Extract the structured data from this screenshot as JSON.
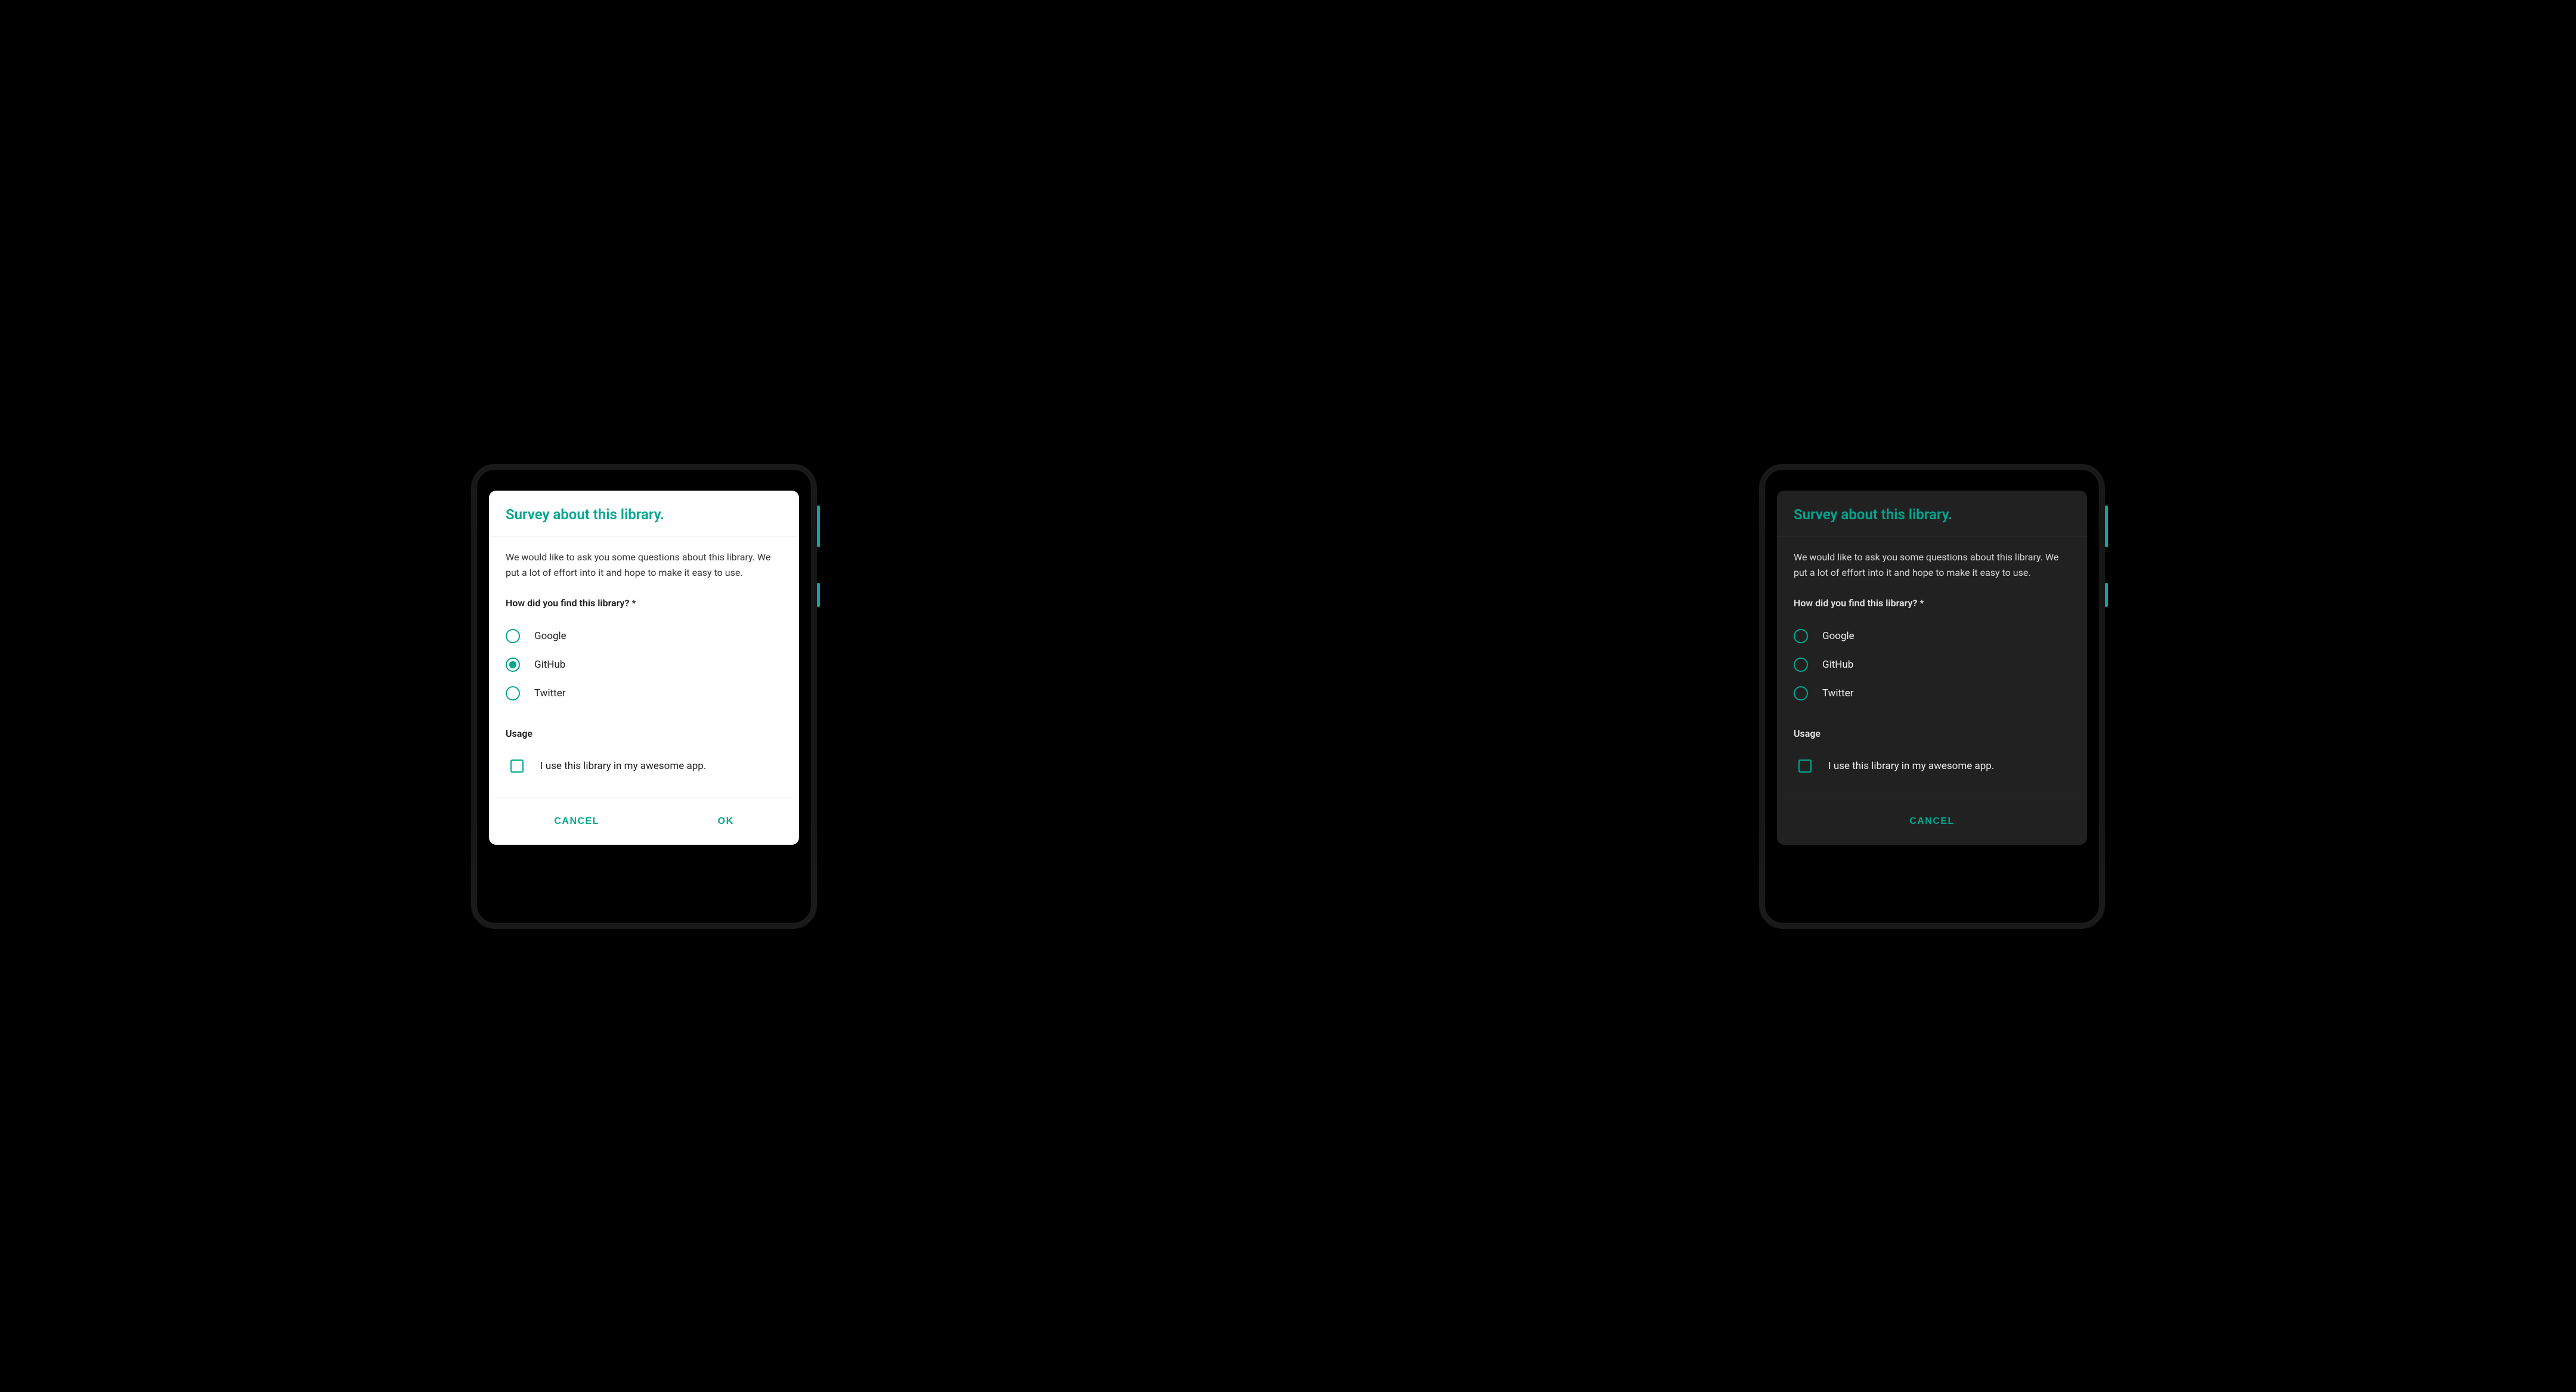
{
  "accent": "#00a78e",
  "light": {
    "theme": "light",
    "title": "Survey about this library.",
    "intro": "We would like to ask you some questions about this library. We put a lot of effort into it and hope to make it easy to use.",
    "question1": "How did you find this library? *",
    "options": [
      {
        "label": "Google",
        "selected": false
      },
      {
        "label": "GitHub",
        "selected": true
      },
      {
        "label": "Twitter",
        "selected": false
      }
    ],
    "section2": "Usage",
    "checkbox_label": "I use this library in my awesome app.",
    "checkbox_checked": false,
    "cancel": "CANCEL",
    "ok": "OK"
  },
  "dark": {
    "theme": "dark",
    "title": "Survey about this library.",
    "intro": "We would like to ask you some questions about this library. We put a lot of effort into it and hope to make it easy to use.",
    "question1": "How did you find this library? *",
    "options": [
      {
        "label": "Google",
        "selected": false
      },
      {
        "label": "GitHub",
        "selected": false
      },
      {
        "label": "Twitter",
        "selected": false
      }
    ],
    "section2": "Usage",
    "checkbox_label": "I use this library in my awesome app.",
    "checkbox_checked": false,
    "cancel": "CANCEL"
  }
}
